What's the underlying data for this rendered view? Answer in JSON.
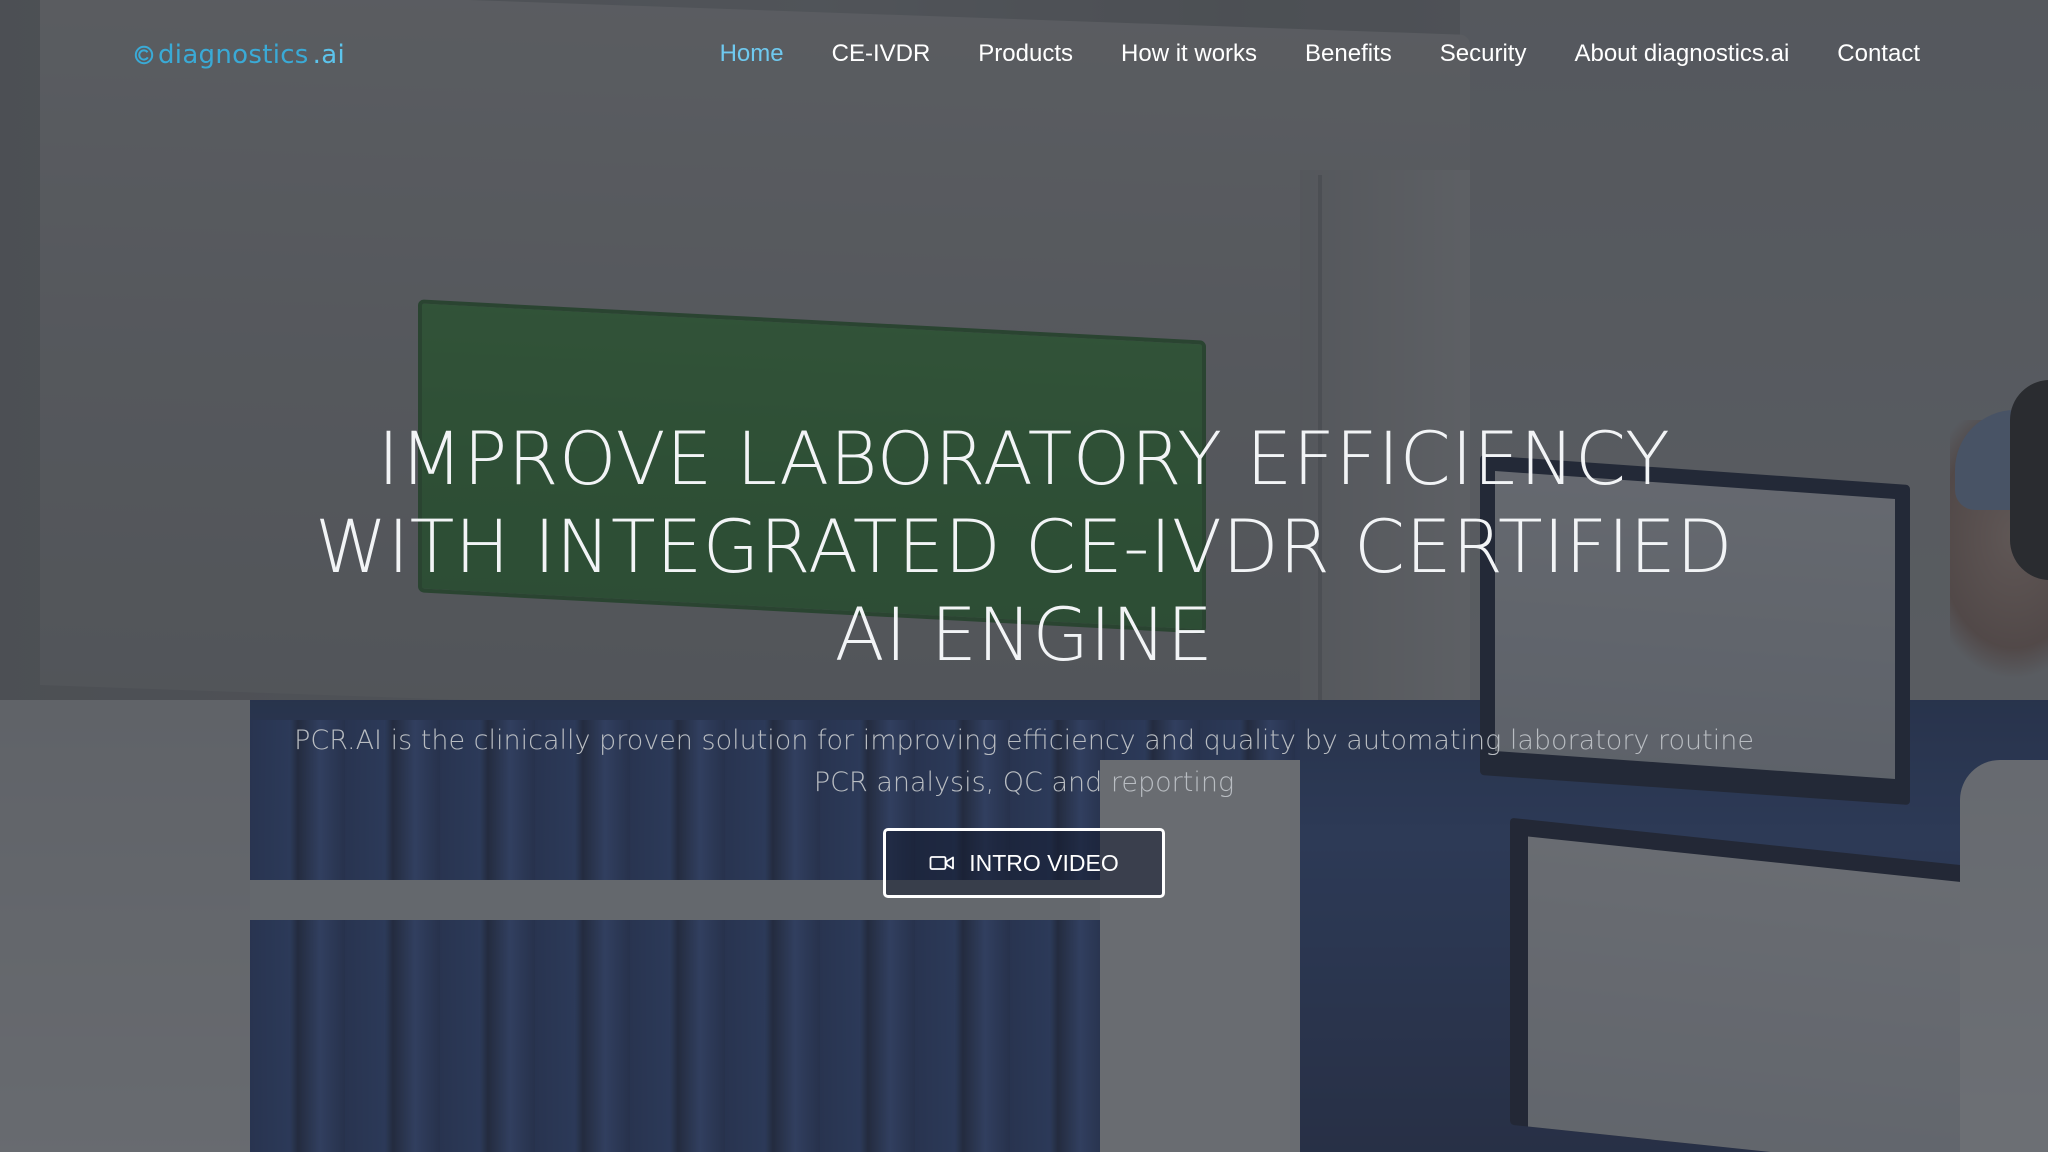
{
  "brand": {
    "logo_name": "diagnostics",
    "logo_suffix": ".ai",
    "logo_color": "#3aaad6"
  },
  "nav": {
    "items": [
      {
        "label": "Home",
        "active": true
      },
      {
        "label": "CE-IVDR",
        "active": false
      },
      {
        "label": "Products",
        "active": false
      },
      {
        "label": "How it works",
        "active": false
      },
      {
        "label": "Benefits",
        "active": false
      },
      {
        "label": "Security",
        "active": false
      },
      {
        "label": "About diagnostics.ai",
        "active": false
      },
      {
        "label": "Contact",
        "active": false
      }
    ],
    "active_color": "#6fc9ef"
  },
  "hero": {
    "headline": "IMPROVE LABORATORY EFFICIENCY WITH INTEGRATED CE-IVDR CERTIFIED AI ENGINE",
    "subtext": "PCR.AI is the clinically proven solution for improving efficiency and quality by automating laboratory routine PCR analysis, QC and reporting",
    "cta_label": "INTRO VIDEO",
    "cta_icon": "video-camera-icon"
  }
}
